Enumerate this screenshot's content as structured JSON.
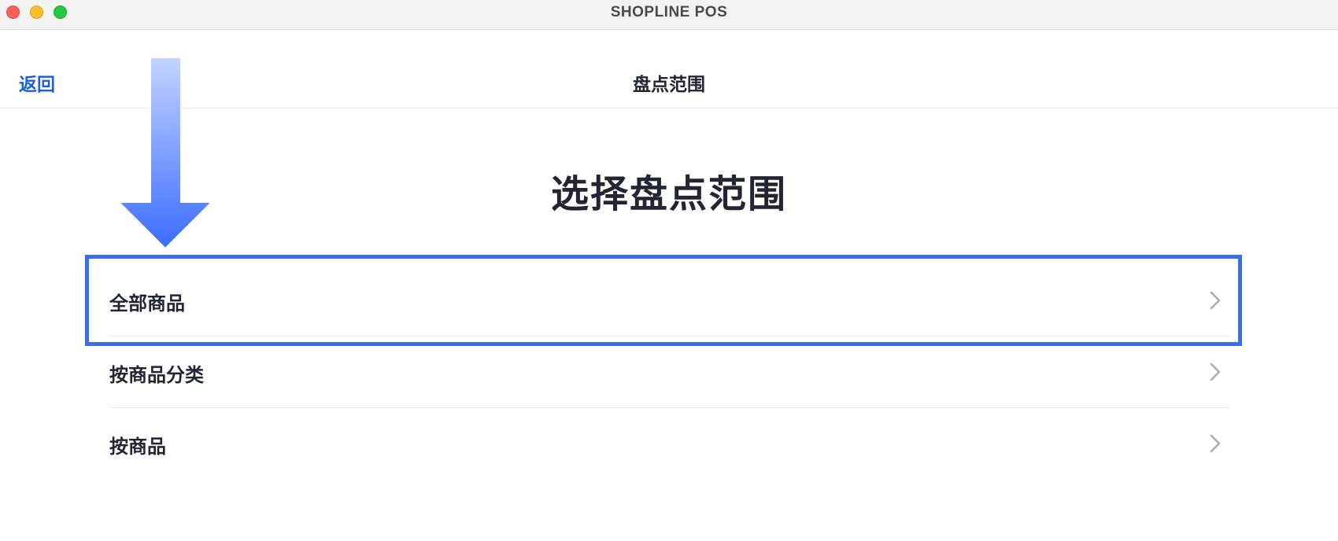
{
  "window": {
    "title": "SHOPLINE POS"
  },
  "navbar": {
    "back_label": "返回",
    "title": "盘点范围"
  },
  "main": {
    "heading": "选择盘点范围",
    "options": [
      {
        "label": "全部商品",
        "selected": true
      },
      {
        "label": "按商品分类",
        "selected": false
      },
      {
        "label": "按商品",
        "selected": false
      }
    ]
  },
  "colors": {
    "accent": "#1f5fd6",
    "highlight": "#3a6ee8",
    "arrow_top": "#c3d4ff",
    "arrow_bottom": "#3b6cff"
  },
  "icons": {
    "row_chevron": "chevron-right-icon",
    "annotation_arrow": "down-arrow-icon"
  }
}
